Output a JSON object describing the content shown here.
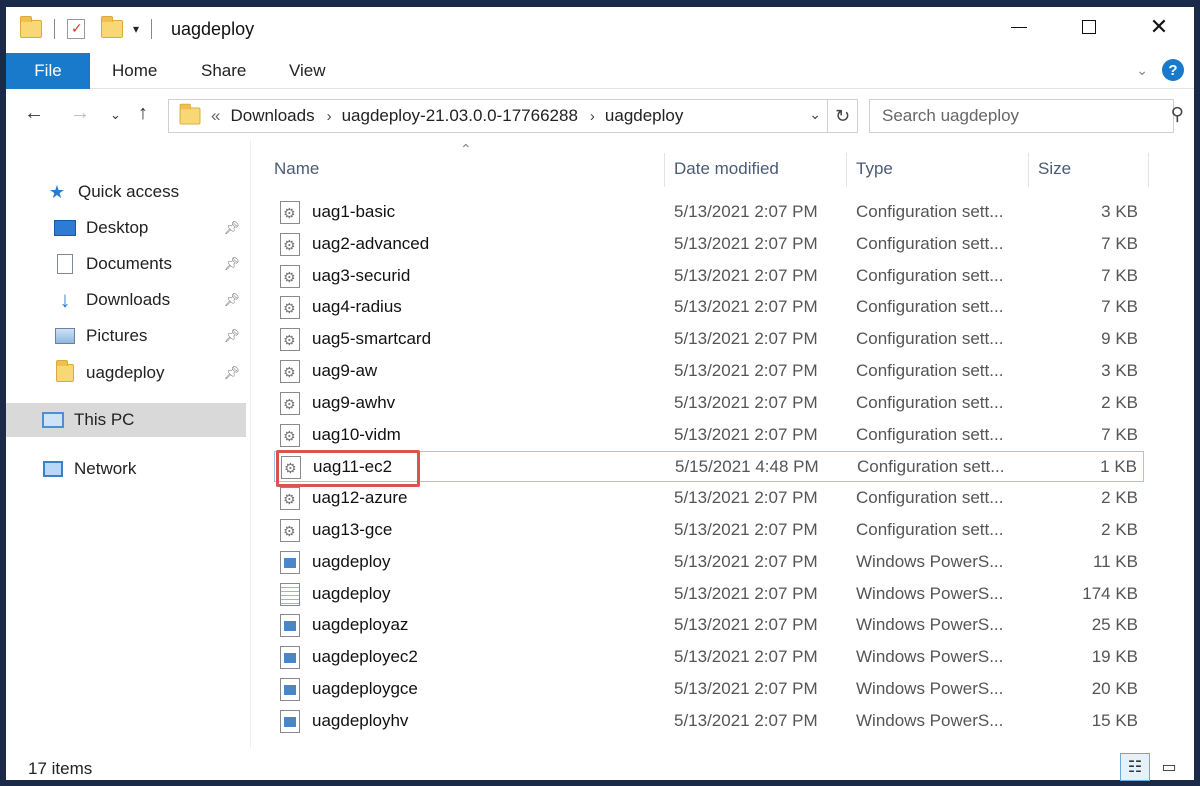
{
  "window": {
    "title": "uagdeploy"
  },
  "ribbon": {
    "tabs": [
      "File",
      "Home",
      "Share",
      "View"
    ]
  },
  "address": {
    "prefix": "«",
    "crumbs": [
      "Downloads",
      "uagdeploy-21.03.0.0-17766288",
      "uagdeploy"
    ]
  },
  "search": {
    "placeholder": "Search uagdeploy"
  },
  "nav": {
    "items": [
      {
        "label": "Quick access",
        "icon": "star-icon",
        "pinned": false
      },
      {
        "label": "Desktop",
        "icon": "desktop-icon",
        "pinned": true
      },
      {
        "label": "Documents",
        "icon": "documents-icon",
        "pinned": true
      },
      {
        "label": "Downloads",
        "icon": "downloads-icon",
        "pinned": true
      },
      {
        "label": "Pictures",
        "icon": "pictures-icon",
        "pinned": true
      },
      {
        "label": "uagdeploy",
        "icon": "folder-icon",
        "pinned": true
      },
      {
        "label": "This PC",
        "icon": "pc-icon",
        "pinned": false,
        "selected": true
      },
      {
        "label": "Network",
        "icon": "network-icon",
        "pinned": false
      }
    ]
  },
  "columns": {
    "name": "Name",
    "date": "Date modified",
    "type": "Type",
    "size": "Size"
  },
  "files": [
    {
      "name": "uag1-basic",
      "date": "5/13/2021 2:07 PM",
      "type": "Configuration sett...",
      "size": "3 KB",
      "icon": "config-file-icon"
    },
    {
      "name": "uag2-advanced",
      "date": "5/13/2021 2:07 PM",
      "type": "Configuration sett...",
      "size": "7 KB",
      "icon": "config-file-icon"
    },
    {
      "name": "uag3-securid",
      "date": "5/13/2021 2:07 PM",
      "type": "Configuration sett...",
      "size": "7 KB",
      "icon": "config-file-icon"
    },
    {
      "name": "uag4-radius",
      "date": "5/13/2021 2:07 PM",
      "type": "Configuration sett...",
      "size": "7 KB",
      "icon": "config-file-icon"
    },
    {
      "name": "uag5-smartcard",
      "date": "5/13/2021 2:07 PM",
      "type": "Configuration sett...",
      "size": "9 KB",
      "icon": "config-file-icon"
    },
    {
      "name": "uag9-aw",
      "date": "5/13/2021 2:07 PM",
      "type": "Configuration sett...",
      "size": "3 KB",
      "icon": "config-file-icon"
    },
    {
      "name": "uag9-awhv",
      "date": "5/13/2021 2:07 PM",
      "type": "Configuration sett...",
      "size": "2 KB",
      "icon": "config-file-icon"
    },
    {
      "name": "uag10-vidm",
      "date": "5/13/2021 2:07 PM",
      "type": "Configuration sett...",
      "size": "7 KB",
      "icon": "config-file-icon"
    },
    {
      "name": "uag11-ec2",
      "date": "5/15/2021 4:48 PM",
      "type": "Configuration sett...",
      "size": "1 KB",
      "icon": "config-file-icon",
      "focused": true,
      "highlighted": true
    },
    {
      "name": "uag12-azure",
      "date": "5/13/2021 2:07 PM",
      "type": "Configuration sett...",
      "size": "2 KB",
      "icon": "config-file-icon"
    },
    {
      "name": "uag13-gce",
      "date": "5/13/2021 2:07 PM",
      "type": "Configuration sett...",
      "size": "2 KB",
      "icon": "config-file-icon"
    },
    {
      "name": "uagdeploy",
      "date": "5/13/2021 2:07 PM",
      "type": "Windows PowerS...",
      "size": "11 KB",
      "icon": "powershell-file-icon"
    },
    {
      "name": "uagdeploy",
      "date": "5/13/2021 2:07 PM",
      "type": "Windows PowerS...",
      "size": "174 KB",
      "icon": "text-file-icon"
    },
    {
      "name": "uagdeployaz",
      "date": "5/13/2021 2:07 PM",
      "type": "Windows PowerS...",
      "size": "25 KB",
      "icon": "powershell-file-icon"
    },
    {
      "name": "uagdeployec2",
      "date": "5/13/2021 2:07 PM",
      "type": "Windows PowerS...",
      "size": "19 KB",
      "icon": "powershell-file-icon"
    },
    {
      "name": "uagdeploygce",
      "date": "5/13/2021 2:07 PM",
      "type": "Windows PowerS...",
      "size": "20 KB",
      "icon": "powershell-file-icon"
    },
    {
      "name": "uagdeployhv",
      "date": "5/13/2021 2:07 PM",
      "type": "Windows PowerS...",
      "size": "15 KB",
      "icon": "powershell-file-icon"
    }
  ],
  "status": {
    "count": "17 items"
  },
  "colors": {
    "accent": "#1979ca",
    "highlight_border": "#d9534f",
    "focus_border": "#99c9f0",
    "selected_nav_bg": "#d9d9d9"
  }
}
